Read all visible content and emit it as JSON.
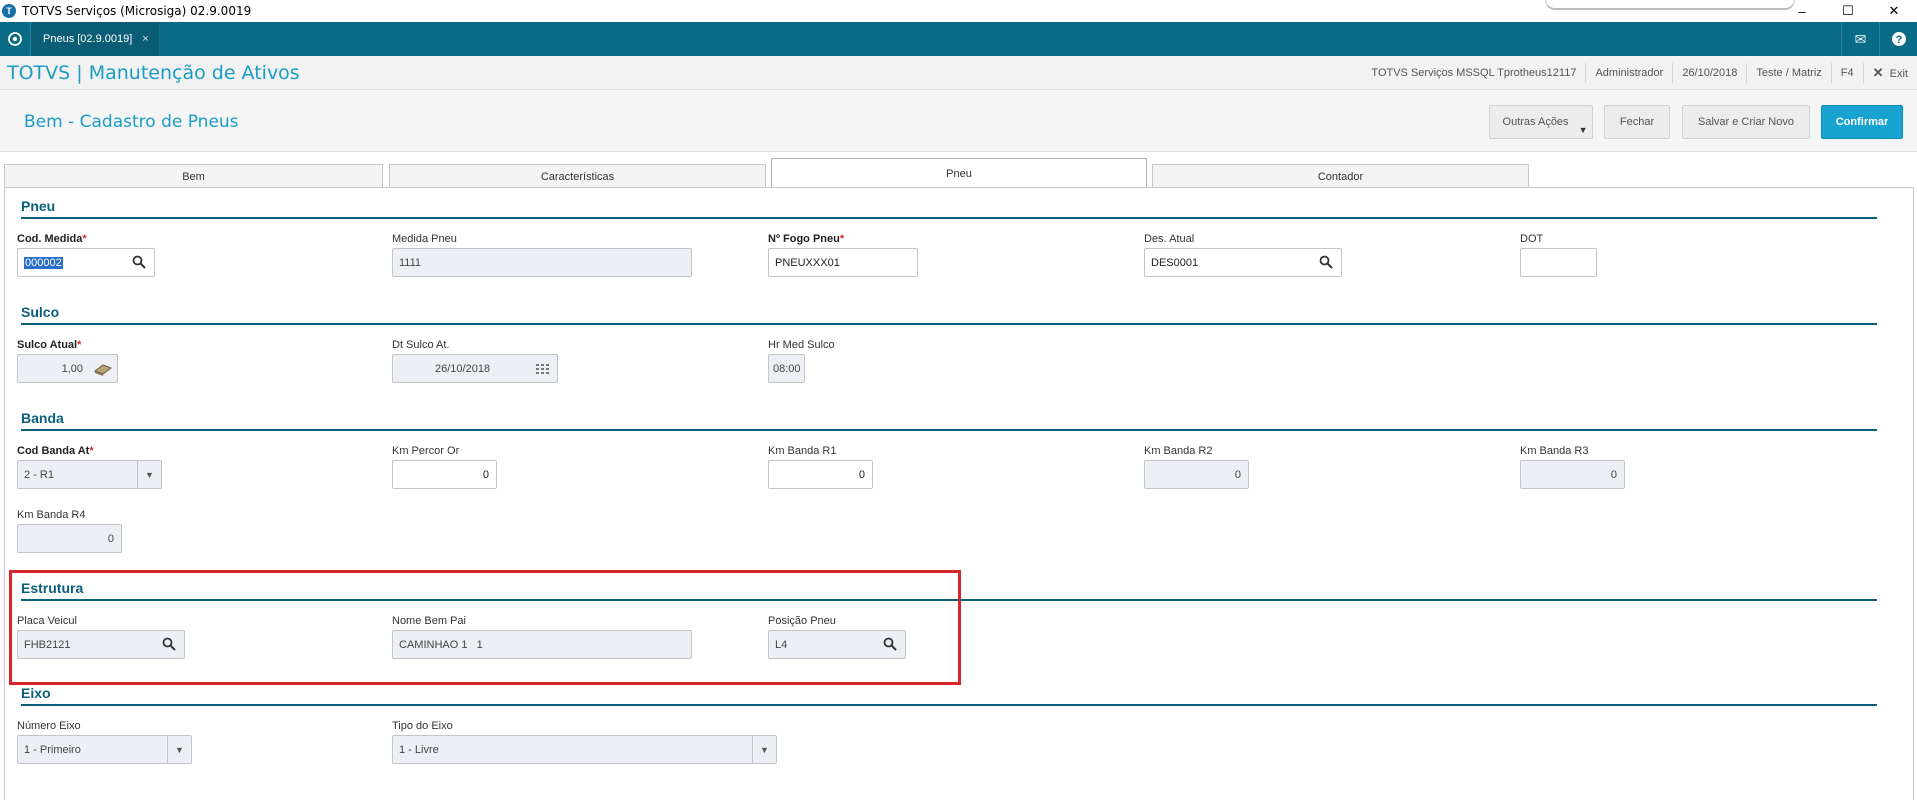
{
  "window": {
    "title": "TOTVS Serviços (Microsiga) 02.9.0019",
    "minimize": "–",
    "maximize": "☐",
    "close": "✕"
  },
  "tabstrip": {
    "tab_label": "Pneus [02.9.0019]",
    "tab_close": "×",
    "mail_icon": "✉",
    "help_icon": "?"
  },
  "module": {
    "title": "TOTVS | Manutenção de Ativos",
    "company": "TOTVS Serviços MSSQL Tprotheus12117",
    "user": "Administrador",
    "date": "26/10/2018",
    "branch": "Teste / Matriz",
    "shortcut": "F4",
    "exit": "Exit"
  },
  "form": {
    "title": "Bem - Cadastro de Pneus",
    "buttons": {
      "outras_acoes": "Outras Ações",
      "fechar": "Fechar",
      "salvar_criar": "Salvar e Criar Novo",
      "confirmar": "Confirmar"
    }
  },
  "folders": [
    "Bem",
    "Características",
    "Pneu",
    "Contador"
  ],
  "active_folder": "Pneu",
  "sections": {
    "pneu": "Pneu",
    "sulco": "Sulco",
    "banda": "Banda",
    "estrutura": "Estrutura",
    "eixo": "Eixo"
  },
  "fields": {
    "cod_medida": {
      "label": "Cod. Medida",
      "value": "000002"
    },
    "medida_pneu": {
      "label": "Medida Pneu",
      "value": "1111"
    },
    "nro_fogo": {
      "label": "Nº Fogo Pneu",
      "value": "PNEUXXX01"
    },
    "des_atual": {
      "label": "Des. Atual",
      "value": "DES0001"
    },
    "dot": {
      "label": "DOT",
      "value": ""
    },
    "sulco_atual": {
      "label": "Sulco Atual",
      "value": "1,00"
    },
    "dt_sulco": {
      "label": "Dt Sulco At.",
      "value": "26/10/2018"
    },
    "hr_med_sulco": {
      "label": "Hr Med Sulco",
      "value": "08:00"
    },
    "cod_banda": {
      "label": "Cod Banda At",
      "value": "2 - R1"
    },
    "km_percor": {
      "label": "Km Percor Or",
      "value": "0"
    },
    "km_r1": {
      "label": "Km Banda R1",
      "value": "0"
    },
    "km_r2": {
      "label": "Km Banda R2",
      "value": "0"
    },
    "km_r3": {
      "label": "Km Banda R3",
      "value": "0"
    },
    "km_r4": {
      "label": "Km Banda R4",
      "value": "0"
    },
    "placa": {
      "label": "Placa Veicul",
      "value": "FHB2121"
    },
    "nome_bem_pai": {
      "label": "Nome Bem Pai",
      "value": "CAMINHAO 1   1"
    },
    "posicao": {
      "label": "Posição Pneu",
      "value": "L4"
    },
    "numero_eixo": {
      "label": "Número Eixo",
      "value": "1 - Primeiro"
    },
    "tipo_eixo": {
      "label": "Tipo do Eixo",
      "value": "1 - Livre"
    }
  },
  "required_mark": "*",
  "colors": {
    "teal": "#0a6b86",
    "accent": "#1a9cc4",
    "primary_button": "#17a2cf",
    "section": "#0a5f7a",
    "highlight": "#d8242c"
  }
}
